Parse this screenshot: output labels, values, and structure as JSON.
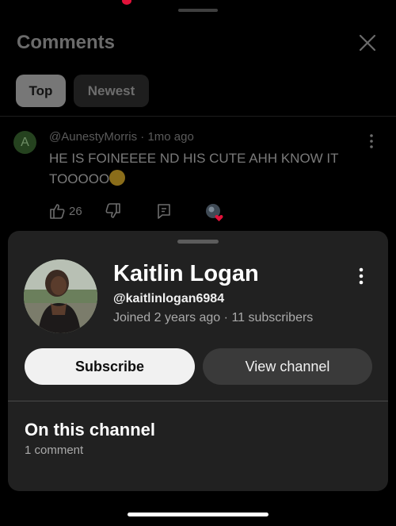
{
  "header": {
    "title": "Comments",
    "close_icon": "close-icon"
  },
  "filters": {
    "top_label": "Top",
    "newest_label": "Newest",
    "selected": "Top"
  },
  "comment": {
    "avatar_letter": "A",
    "author": "@AunestyMorris",
    "separator": "·",
    "time": "1mo ago",
    "text": "HE IS FOINEEEE ND HIS CUTE AHH KNOW IT TOOOOO",
    "emoji_icon": "weary-face-emoji",
    "like_count": "26",
    "icons": [
      "thumbs-up-icon",
      "thumbs-down-icon",
      "reply-icon",
      "creator-heart-icon",
      "more-vertical-icon"
    ]
  },
  "channel_sheet": {
    "name": "Kaitlin Logan",
    "handle": "@kaitlinlogan6984",
    "joined": "Joined 2 years ago",
    "dot": "·",
    "subscribers": "11 subscribers",
    "subscribe_label": "Subscribe",
    "view_channel_label": "View channel",
    "section_title": "On this channel",
    "section_count": "1 comment"
  },
  "colors": {
    "background": "#000000",
    "sheet": "#212121",
    "subscribe_bg": "#f1f1f1",
    "view_channel_bg": "#3a3a3a",
    "heart": "#e2123a"
  }
}
